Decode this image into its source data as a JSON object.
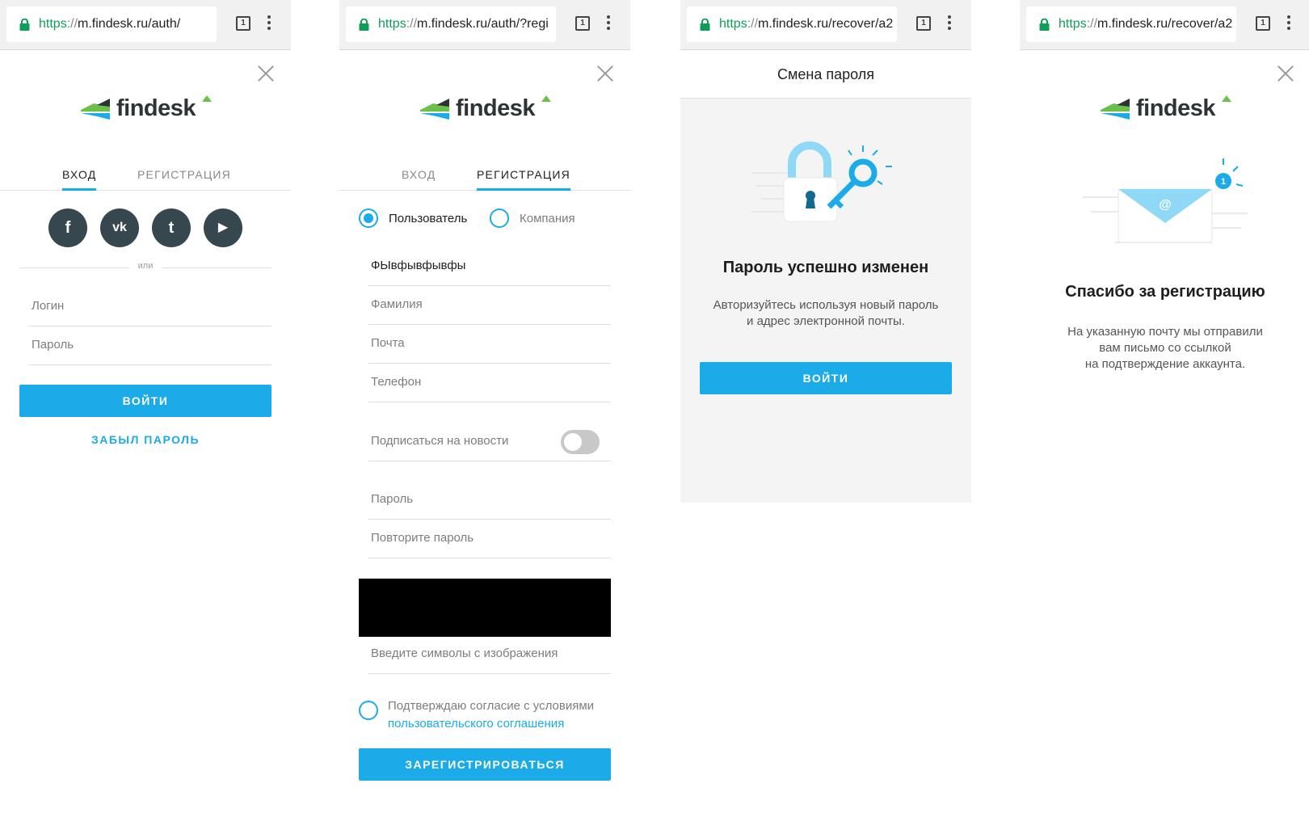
{
  "screens": [
    {
      "url": {
        "scheme": "https",
        "sep": "://",
        "rest": "m.findesk.ru/auth/"
      },
      "tab_count": "1",
      "logo": "findesk",
      "tabs": {
        "login": "ВХОД",
        "register": "РЕГИСТРАЦИЯ"
      },
      "social": [
        {
          "icon": "facebook-icon",
          "glyph": "f"
        },
        {
          "icon": "vk-icon",
          "glyph": "vk"
        },
        {
          "icon": "twitter-icon",
          "glyph": "t"
        },
        {
          "icon": "youtube-icon",
          "glyph": "▶"
        }
      ],
      "or_label": "или",
      "login_placeholder": "Логин",
      "password_placeholder": "Пароль",
      "submit": "ВОЙТИ",
      "forgot": "ЗАБЫЛ ПАРОЛЬ"
    },
    {
      "url": {
        "scheme": "https",
        "sep": "://",
        "rest": "m.findesk.ru/auth/?regi"
      },
      "tab_count": "1",
      "logo": "findesk",
      "tabs": {
        "login": "ВХОД",
        "register": "РЕГИСТРАЦИЯ"
      },
      "account_type": {
        "user": "Пользователь",
        "company": "Компания",
        "selected": "user"
      },
      "fields": {
        "first_name_value": "ФЫвфывфывфы",
        "last_name": "Фамилия",
        "email": "Почта",
        "phone": "Телефон",
        "newsletter": "Подписаться на новости",
        "password": "Пароль",
        "password_repeat": "Повторите пароль",
        "captcha": "Введите символы с изображения"
      },
      "newsletter_on": false,
      "agree_text": "Подтверждаю согласие с условиями",
      "agree_link": "пользовательского соглашения",
      "submit": "ЗАРЕГИСТРИРОВАТЬСЯ"
    },
    {
      "url": {
        "scheme": "https",
        "sep": "://",
        "rest": "m.findesk.ru/recover/a2"
      },
      "tab_count": "1",
      "header": "Смена пароля",
      "heading": "Пароль успешно изменен",
      "message_line1": "Авторизуйтесь используя новый пароль",
      "message_line2": "и адрес электронной почты.",
      "submit": "ВОЙТИ"
    },
    {
      "url": {
        "scheme": "https",
        "sep": "://",
        "rest": "m.findesk.ru/recover/a2"
      },
      "tab_count": "1",
      "logo": "findesk",
      "envelope_badge": "1",
      "envelope_symbol": "@",
      "heading": "Спасибо за регистрацию",
      "message_line1": "На указанную почту мы отправили",
      "message_line2": "вам письмо со ссылкой",
      "message_line3": "на подтверждение аккаунта."
    }
  ],
  "colors": {
    "accent": "#1aabe8",
    "social_bg": "#36474f",
    "logo_green": "#6cc04a",
    "logo_dark": "#2d3436",
    "secure_green": "#0f9d58"
  }
}
